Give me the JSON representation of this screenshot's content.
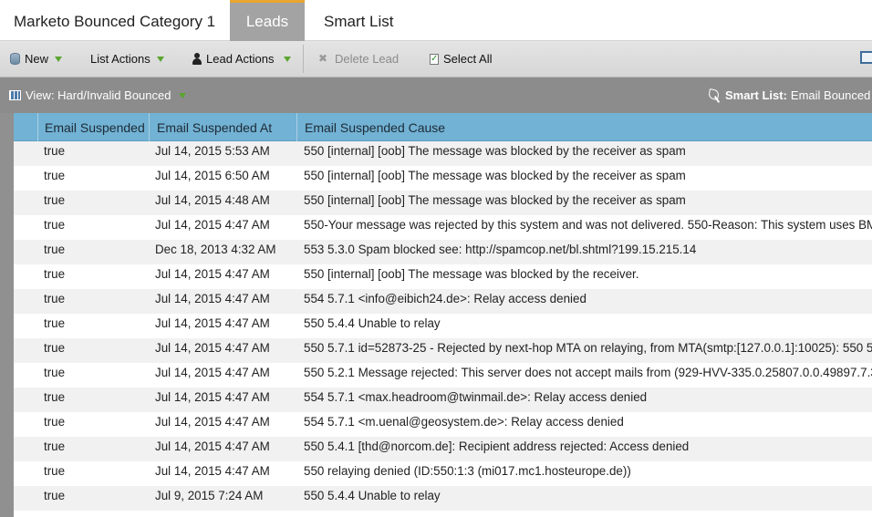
{
  "tabs": [
    {
      "label": "Marketo Bounced Category 1",
      "active": false
    },
    {
      "label": "Leads",
      "active": true
    },
    {
      "label": "Smart List",
      "active": false
    }
  ],
  "toolbar": {
    "new_label": "New",
    "list_actions_label": "List Actions",
    "lead_actions_label": "Lead Actions",
    "delete_lead_label": "Delete Lead",
    "select_all_label": "Select All"
  },
  "viewbar": {
    "view_label": "View: Hard/Invalid Bounced",
    "smart_list_prefix": "Smart List:",
    "smart_list_value": "Email Bounced"
  },
  "grid": {
    "columns": [
      "Email Suspended",
      "Email Suspended At",
      "Email Suspended Cause"
    ],
    "rows": [
      [
        "true",
        "Jul 14, 2015 5:53 AM",
        "550 [internal] [oob] The message was blocked by the receiver as spam"
      ],
      [
        "true",
        "Jul 14, 2015 6:50 AM",
        "550 [internal] [oob] The message was blocked by the receiver as spam"
      ],
      [
        "true",
        "Jul 14, 2015 4:48 AM",
        "550 [internal] [oob] The message was blocked by the receiver as spam"
      ],
      [
        "true",
        "Jul 14, 2015 4:47 AM",
        "550-Your message was rejected by this system and was not delivered. 550-Reason: This system uses BM"
      ],
      [
        "true",
        "Dec 18, 2013 4:32 AM",
        "553 5.3.0 Spam blocked see: http://spamcop.net/bl.shtml?199.15.215.14"
      ],
      [
        "true",
        "Jul 14, 2015 4:47 AM",
        "550 [internal] [oob] The message was blocked by the receiver."
      ],
      [
        "true",
        "Jul 14, 2015 4:47 AM",
        "554 5.7.1 <info@eibich24.de>: Relay access denied"
      ],
      [
        "true",
        "Jul 14, 2015 4:47 AM",
        "550 5.4.4 Unable to relay"
      ],
      [
        "true",
        "Jul 14, 2015 4:47 AM",
        "550 5.7.1 id=52873-25 - Rejected by next-hop MTA on relaying, from MTA(smtp:[127.0.0.1]:10025): 550 5"
      ],
      [
        "true",
        "Jul 14, 2015 4:47 AM",
        "550 5.2.1 Message rejected: This server does not accept mails from (929-HVV-335.0.25807.0.0.49897.7.3"
      ],
      [
        "true",
        "Jul 14, 2015 4:47 AM",
        "554 5.7.1 <max.headroom@twinmail.de>: Relay access denied"
      ],
      [
        "true",
        "Jul 14, 2015 4:47 AM",
        "554 5.7.1 <m.uenal@geosystem.de>: Relay access denied"
      ],
      [
        "true",
        "Jul 14, 2015 4:47 AM",
        "550 5.4.1 [thd@norcom.de]: Recipient address rejected: Access denied"
      ],
      [
        "true",
        "Jul 14, 2015 4:47 AM",
        "550 relaying denied (ID:550:1:3 (mi017.mc1.hosteurope.de))"
      ],
      [
        "true",
        "Jul 9, 2015 7:24 AM",
        "550 5.4.4 Unable to relay"
      ]
    ]
  },
  "colors": {
    "active_tab": "#a3a3a3",
    "active_tab_accent": "#e8a530",
    "grid_header": "#72b2d4",
    "viewbar": "#8c8c8c",
    "caret": "#5aa52f"
  }
}
